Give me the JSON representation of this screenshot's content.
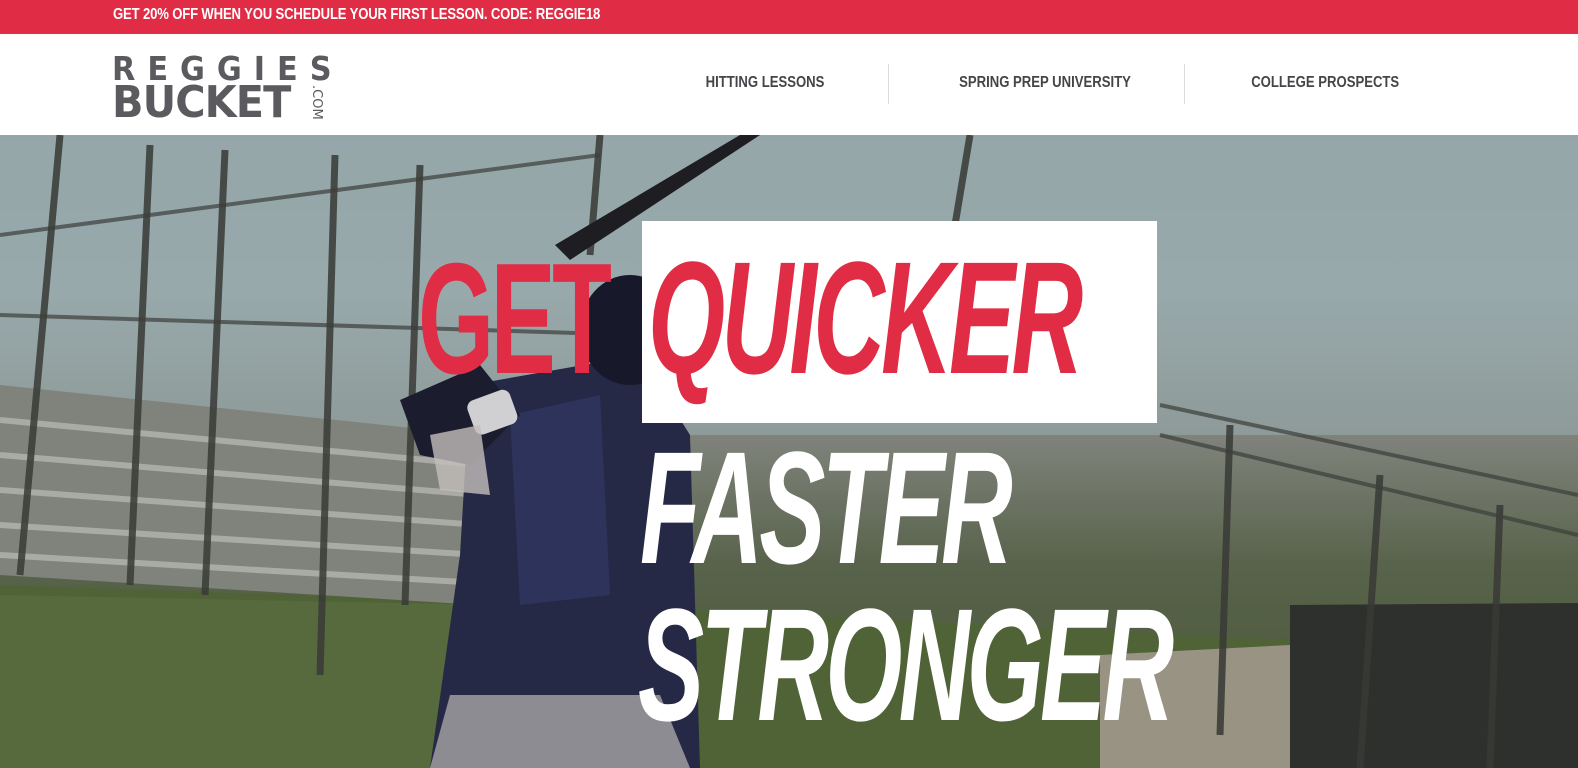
{
  "promo": {
    "text": "GET 20% OFF WHEN YOU SCHEDULE YOUR FIRST LESSON. CODE: REGGIE18",
    "color": "#e02c44"
  },
  "header": {
    "logo": {
      "line1": "REGGIES",
      "line2": "BUCKET",
      "suffix": ".COM"
    },
    "nav": [
      {
        "label": "HITTING LESSONS"
      },
      {
        "label": "SPRING PREP UNIVERSITY"
      },
      {
        "label": "COLLEGE PROSPECTS"
      }
    ]
  },
  "hero": {
    "image_subject": "baseball batter at practice field",
    "headline": {
      "get": "GET",
      "quicker": "QUICKER",
      "faster": "FASTER",
      "stronger": "STRONGER"
    },
    "accent_color": "#e02c44",
    "text_color": "#ffffff"
  }
}
